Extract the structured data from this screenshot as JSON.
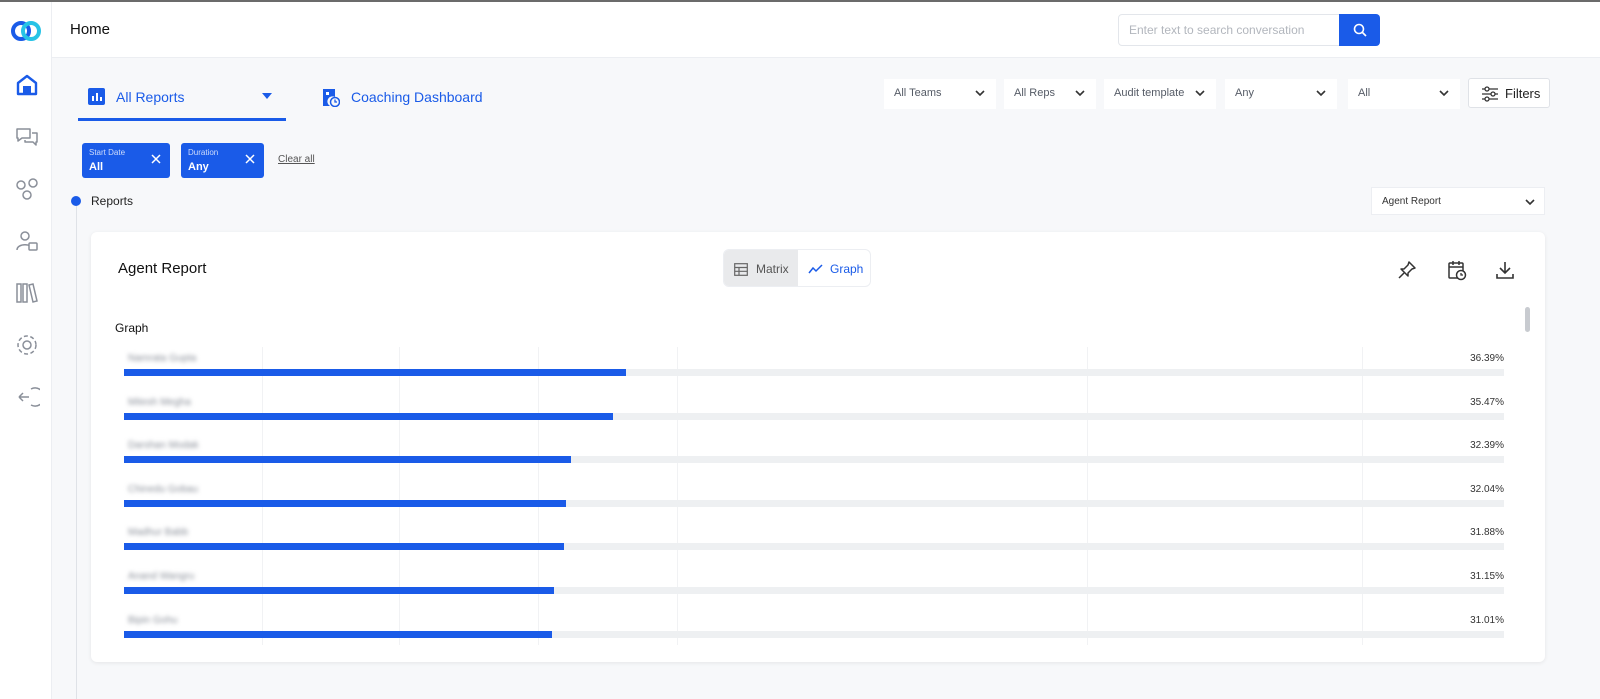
{
  "header": {
    "title": "Home",
    "search_placeholder": "Enter text to search conversation"
  },
  "tabs": [
    {
      "label": "All Reports",
      "active": true
    },
    {
      "label": "Coaching Dashboard",
      "active": false
    }
  ],
  "filters": {
    "teams": "All Teams",
    "reps": "All Reps",
    "template": "Audit template",
    "any": "Any",
    "all": "All",
    "button": "Filters"
  },
  "chips": [
    {
      "key": "Start Date",
      "value": "All"
    },
    {
      "key": "Duration",
      "value": "Any"
    }
  ],
  "clear_all": "Clear all",
  "section_label": "Reports",
  "report_select": "Agent Report",
  "card": {
    "title": "Agent Report",
    "view_toggle": {
      "matrix": "Matrix",
      "graph": "Graph",
      "selected": "Graph"
    },
    "graph_title": "Graph"
  },
  "colors": {
    "accent": "#1a5be8"
  },
  "chart_data": {
    "type": "bar",
    "orientation": "horizontal",
    "categories": [
      "Namrata Gupta",
      "Mitesh Megha",
      "Darshan Modak",
      "Chinedu Gobau",
      "Madhur Babb",
      "Anand Wangru",
      "Bipin Gohu"
    ],
    "values": [
      36.39,
      35.47,
      32.39,
      32.04,
      31.88,
      31.15,
      31.01
    ],
    "value_labels": [
      "36.39%",
      "35.47%",
      "32.39%",
      "32.04%",
      "31.88%",
      "31.15%",
      "31.01%"
    ],
    "xlim": [
      0,
      100
    ],
    "grid": true,
    "title": "Graph"
  }
}
